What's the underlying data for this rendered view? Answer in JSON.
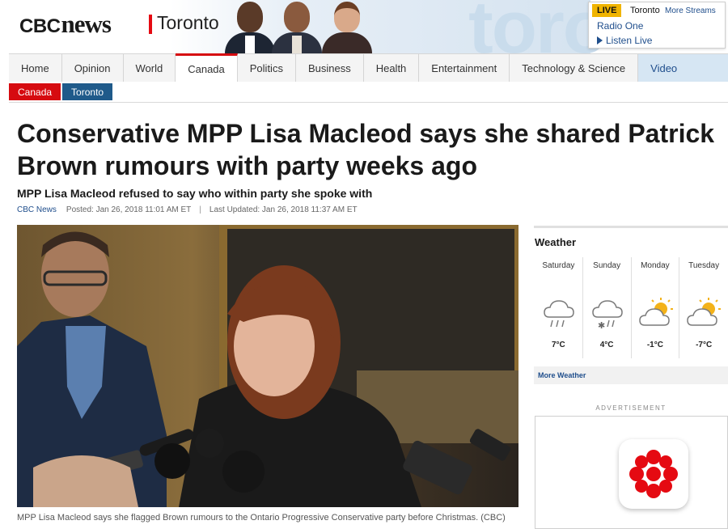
{
  "header": {
    "logo_cbc": "CBC",
    "logo_news": "news",
    "city": "Toronto"
  },
  "live": {
    "badge": "LIVE",
    "city": "Toronto",
    "more_streams": "More Streams",
    "station": "Radio One",
    "listen": "Listen Live"
  },
  "nav": {
    "items": [
      "Home",
      "Opinion",
      "World",
      "Canada",
      "Politics",
      "Business",
      "Health",
      "Entertainment",
      "Technology & Science",
      "Video"
    ],
    "active": "Canada"
  },
  "breadcrumb": [
    "Canada",
    "Toronto"
  ],
  "article": {
    "headline": "Conservative MPP Lisa Macleod says she shared Patrick Brown rumours with party weeks ago",
    "subhead": "MPP Lisa Macleod refused to say who within party she spoke with",
    "source": "CBC News",
    "posted": "Posted: Jan 26, 2018 11:01 AM ET",
    "updated": "Last Updated: Jan 26, 2018 11:37 AM ET",
    "caption": "MPP Lisa Macleod says she flagged Brown rumours to the Ontario Progressive Conservative party before Christmas. (CBC)"
  },
  "weather": {
    "title": "Weather",
    "days": [
      {
        "day": "Saturday",
        "temp": "7°C",
        "icon": "rain-icon"
      },
      {
        "day": "Sunday",
        "temp": "4°C",
        "icon": "snow-rain-icon"
      },
      {
        "day": "Monday",
        "temp": "-1°C",
        "icon": "partly-cloudy-icon"
      },
      {
        "day": "Tuesday",
        "temp": "-7°C",
        "icon": "partly-cloudy-icon"
      }
    ],
    "more": "More Weather"
  },
  "ad": {
    "label": "ADVERTISEMENT"
  },
  "colors": {
    "cbc_red": "#d60b10",
    "link_blue": "#1f4e8c",
    "live_yellow": "#f0b400"
  }
}
